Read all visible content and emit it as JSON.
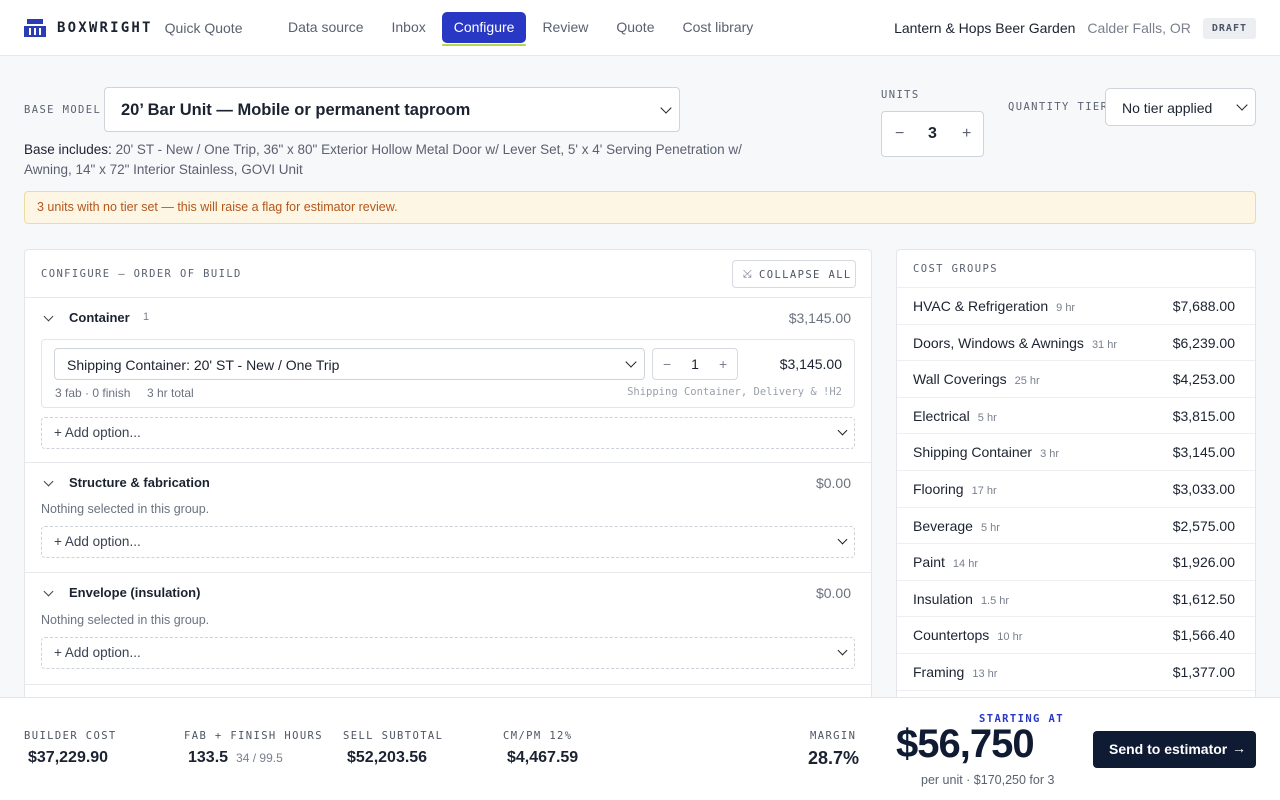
{
  "header": {
    "brand": "BOXWRIGHT",
    "app_name": "Quick Quote",
    "tabs": [
      "Data source",
      "Inbox",
      "Configure",
      "Review",
      "Quote",
      "Cost library"
    ],
    "active_tab": "Configure",
    "project_name": "Lantern & Hops Beer Garden",
    "location": "Calder Falls, OR",
    "status_badge": "DRAFT"
  },
  "base": {
    "label": "BASE MODEL",
    "selected": "20’ Bar Unit — Mobile or permanent taproom",
    "includes_label": "Base includes:",
    "includes_text": "20' ST - New / One Trip, 36\" x 80\" Exterior Hollow Metal Door w/ Lever Set, 5' x 4' Serving Penetration w/ Awning, 14\" x 72\" Interior Stainless, GOVI Unit"
  },
  "units": {
    "label": "UNITS",
    "value": "3",
    "minus": "−",
    "plus": "+"
  },
  "tier": {
    "label": "QUANTITY TIER",
    "selected": "No tier applied"
  },
  "warning": "3 units with no tier set — this will raise a flag for estimator review.",
  "configure": {
    "title": "CONFIGURE — ORDER OF BUILD",
    "collapse_label": "COLLAPSE ALL",
    "groups": [
      {
        "name": "Container",
        "count": "1",
        "total": "$3,145.00",
        "item": {
          "selected": "Shipping Container: 20' ST - New / One Trip",
          "qty": "1",
          "price": "$3,145.00",
          "meta": "3 fab · 0 finish",
          "hours": "3 hr total",
          "tags": "Shipping Container, Delivery & !H2"
        },
        "add_label": "+ Add option..."
      },
      {
        "name": "Structure & fabrication",
        "total": "$0.00",
        "empty": "Nothing selected in this group.",
        "add_label": "+ Add option..."
      },
      {
        "name": "Envelope (insulation)",
        "total": "$0.00",
        "empty": "Nothing selected in this group.",
        "add_label": "+ Add option..."
      }
    ]
  },
  "cost_groups": {
    "title": "COST GROUPS",
    "items": [
      {
        "name": "HVAC & Refrigeration",
        "hours": "9 hr",
        "value": "$7,688.00"
      },
      {
        "name": "Doors, Windows & Awnings",
        "hours": "31 hr",
        "value": "$6,239.00"
      },
      {
        "name": "Wall Coverings",
        "hours": "25 hr",
        "value": "$4,253.00"
      },
      {
        "name": "Electrical",
        "hours": "5 hr",
        "value": "$3,815.00"
      },
      {
        "name": "Shipping Container",
        "hours": "3 hr",
        "value": "$3,145.00"
      },
      {
        "name": "Flooring",
        "hours": "17 hr",
        "value": "$3,033.00"
      },
      {
        "name": "Beverage",
        "hours": "5 hr",
        "value": "$2,575.00"
      },
      {
        "name": "Paint",
        "hours": "14 hr",
        "value": "$1,926.00"
      },
      {
        "name": "Insulation",
        "hours": "1.5 hr",
        "value": "$1,612.50"
      },
      {
        "name": "Countertops",
        "hours": "10 hr",
        "value": "$1,566.40"
      },
      {
        "name": "Framing",
        "hours": "13 hr",
        "value": "$1,377.00"
      }
    ]
  },
  "footer": {
    "builder_cost_label": "BUILDER COST",
    "builder_cost": "$37,229.90",
    "hours_label": "FAB + FINISH HOURS",
    "hours_total": "133.5",
    "hours_split": "34 / 99.5",
    "sell_label": "SELL SUBTOTAL",
    "sell_subtotal": "$52,203.56",
    "cmpm_label": "CM/PM 12%",
    "cmpm_value": "$4,467.59",
    "margin_label": "MARGIN",
    "margin_value": "28.7%",
    "starting_label": "STARTING AT",
    "starting_price": "$56,750",
    "starting_sub": "per unit · $170,250 for 3",
    "send_label": "Send to estimator"
  },
  "colors": {
    "accent": "#2838c4",
    "accent_underline": "#b7d64a",
    "warning_bg": "#fdf6e4",
    "warning_text": "#b4561b",
    "cta": "#0f1a33"
  }
}
